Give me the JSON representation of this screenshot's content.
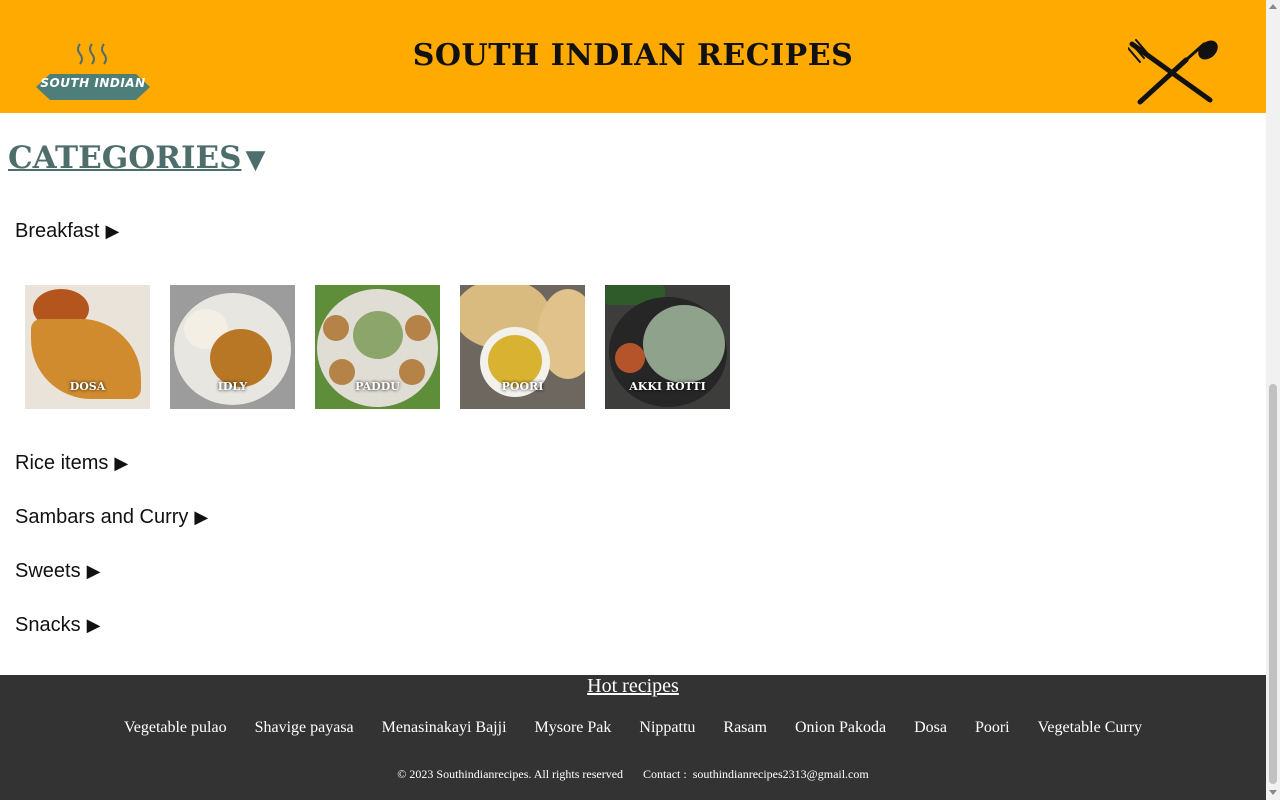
{
  "header": {
    "logo_text": "SOUTH INDIAN",
    "title": "SOUTH INDIAN RECIPES"
  },
  "categories": {
    "title": "CATEGORIES",
    "arrow": "▼",
    "items": [
      {
        "label": "Breakfast",
        "arrow": "▶"
      },
      {
        "label": "Rice items",
        "arrow": "▶"
      },
      {
        "label": "Sambars and Curry",
        "arrow": "▶"
      },
      {
        "label": "Sweets",
        "arrow": "▶"
      },
      {
        "label": "Snacks",
        "arrow": "▶"
      }
    ]
  },
  "breakfast_items": [
    {
      "label": "DOSA"
    },
    {
      "label": "IDLY"
    },
    {
      "label": "PADDU"
    },
    {
      "label": "POORI"
    },
    {
      "label": "AKKI ROTTI"
    }
  ],
  "footer": {
    "hot_title": "Hot recipes",
    "hot_links": [
      "Vegetable pulao",
      "Shavige payasa",
      "Menasinakayi Bajji",
      "Mysore Pak",
      "Nippattu",
      "Rasam",
      "Onion Pakoda",
      "Dosa",
      "Poori",
      "Vegetable Curry"
    ],
    "copyright": "© 2023 Southindianrecipes. All rights reserved",
    "contact_label": "Contact :",
    "contact_email": "southindianrecipes2313@gmail.com"
  },
  "colors": {
    "header_bg": "#FFAA00",
    "categories_color": "#4E6E6C",
    "footer_bg": "#333333"
  }
}
